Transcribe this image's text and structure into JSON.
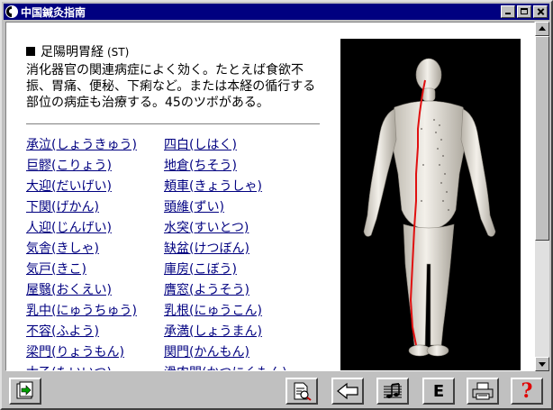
{
  "window": {
    "title": "中国鍼灸指南"
  },
  "section": {
    "title": "足陽明胃経",
    "abbr": "(ST)",
    "description": "消化器官の関連病症によく効く。たとえば食欲不振、胃痛、便秘、下痢など。または本経の循行する部位の病症も治療する。45のツボがある。"
  },
  "points": {
    "col1": [
      "承泣(しょうきゅう)",
      "巨髎(こりょう)",
      "大迎(だいげい)",
      "下関(げかん)",
      "人迎(じんげい)",
      "気舎(きしゃ)",
      "気戸(きこ)",
      "屋翳(おくえい)",
      "乳中(にゅうちゅう)",
      "不容(ふよう)",
      "梁門(りょうもん)",
      "太乙(たいいつ)"
    ],
    "col2": [
      "四白(しはく)",
      "地倉(ちそう)",
      "頬車(きょうしゃ)",
      "頭維(ずい)",
      "水突(すいとつ)",
      "缺盆(けつぼん)",
      "庫房(こぼう)",
      "膺窓(ようそう)",
      "乳根(にゅうこん)",
      "承満(しょうまん)",
      "関門(かんもん)",
      "滑肉門(かつにくもん)"
    ]
  },
  "toolbar": {
    "english_label": "E",
    "help_label": "?"
  },
  "colors": {
    "titlebar": "#000080",
    "link": "#000080",
    "meridian": "#e01010"
  }
}
